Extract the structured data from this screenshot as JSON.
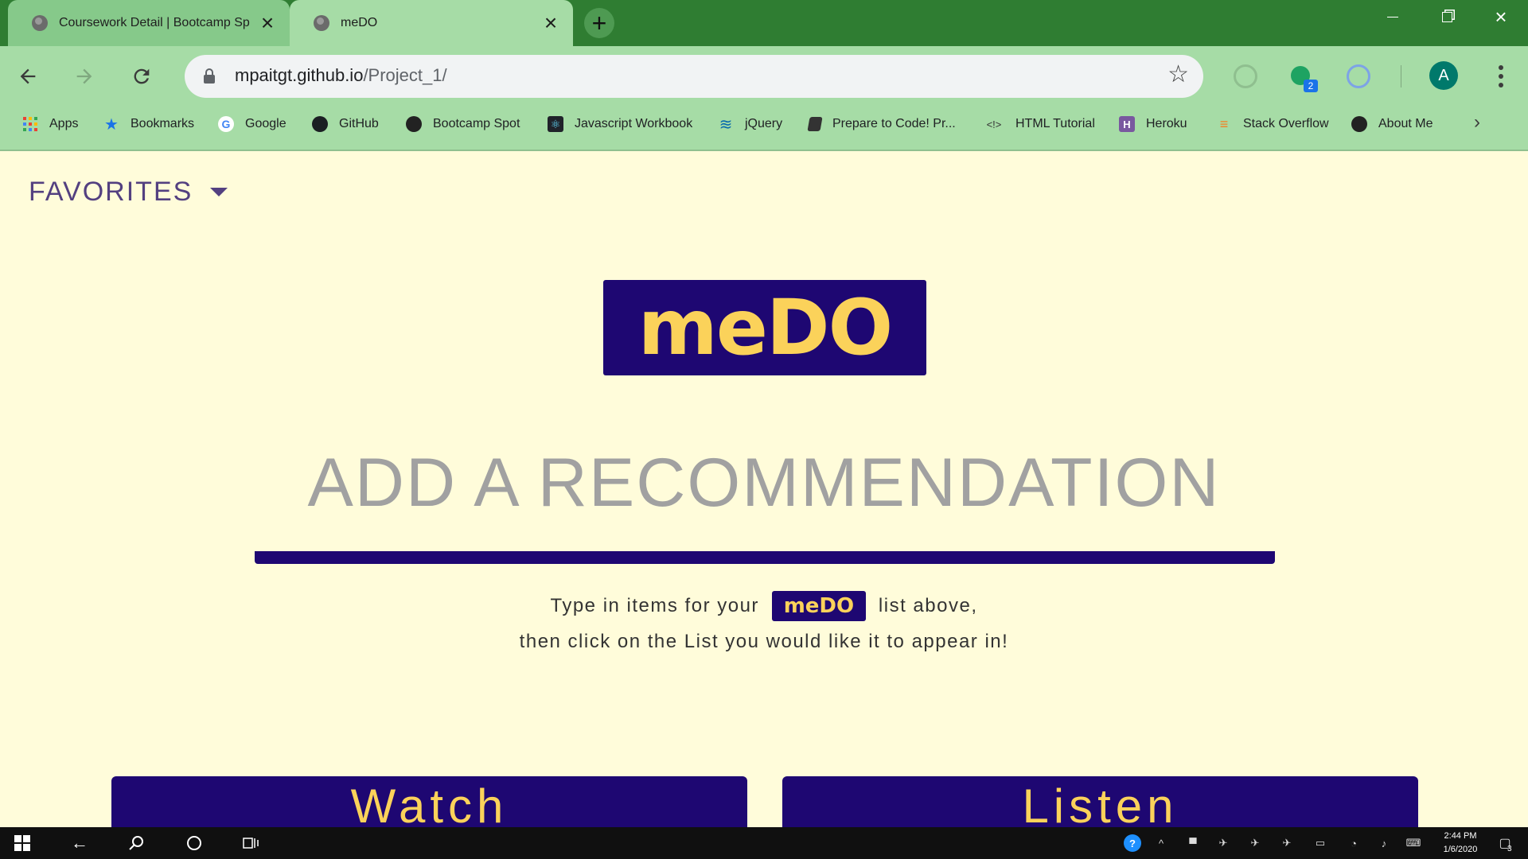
{
  "browser": {
    "tabs": [
      {
        "title": "Coursework Detail | Bootcamp Sp",
        "active": false
      },
      {
        "title": "meDO",
        "active": true
      }
    ],
    "new_tab_symbol": "+",
    "url_host": "mpaitgt.github.io",
    "url_path": "/Project_1/",
    "profile_initial": "A",
    "extension_badge": "2",
    "bookmarks": [
      {
        "label": "Apps",
        "icon": "apps-grid-icon"
      },
      {
        "label": "Bookmarks",
        "icon": "star-icon"
      },
      {
        "label": "Google",
        "icon": "google-icon"
      },
      {
        "label": "GitHub",
        "icon": "github-icon"
      },
      {
        "label": "Bootcamp Spot",
        "icon": "bootcamp-icon"
      },
      {
        "label": "Javascript Workbook",
        "icon": "react-icon"
      },
      {
        "label": "jQuery",
        "icon": "jquery-icon"
      },
      {
        "label": "Prepare to Code! Pr...",
        "icon": "book-icon"
      },
      {
        "label": "HTML Tutorial",
        "icon": "code-icon"
      },
      {
        "label": "Heroku",
        "icon": "heroku-icon"
      },
      {
        "label": "Stack Overflow",
        "icon": "stackoverflow-icon"
      },
      {
        "label": "About Me",
        "icon": "bootcamp-icon"
      }
    ]
  },
  "page": {
    "favorites_label": "FAVORITES",
    "logo_text": "meDO",
    "heading": "ADD A RECOMMENDATION",
    "instruction_before": "Type in items for your",
    "instruction_after": "list above,",
    "instruction_line2": "then click on the List you would like it to appear in!",
    "mini_logo_text": "meDO",
    "cards": [
      {
        "label": "Watch"
      },
      {
        "label": "Listen"
      }
    ]
  },
  "taskbar": {
    "time": "2:44 PM",
    "date": "1/6/2020",
    "notification_count": "3"
  },
  "colors": {
    "page_background": "#fffcda",
    "brand_navy": "#1e0772",
    "brand_yellow": "#fbd25a",
    "favorites_purple": "#534080",
    "heading_gray": "#a1a1a1",
    "chrome_green_dark": "#2f7d32",
    "chrome_green_light": "#a6dca6"
  }
}
